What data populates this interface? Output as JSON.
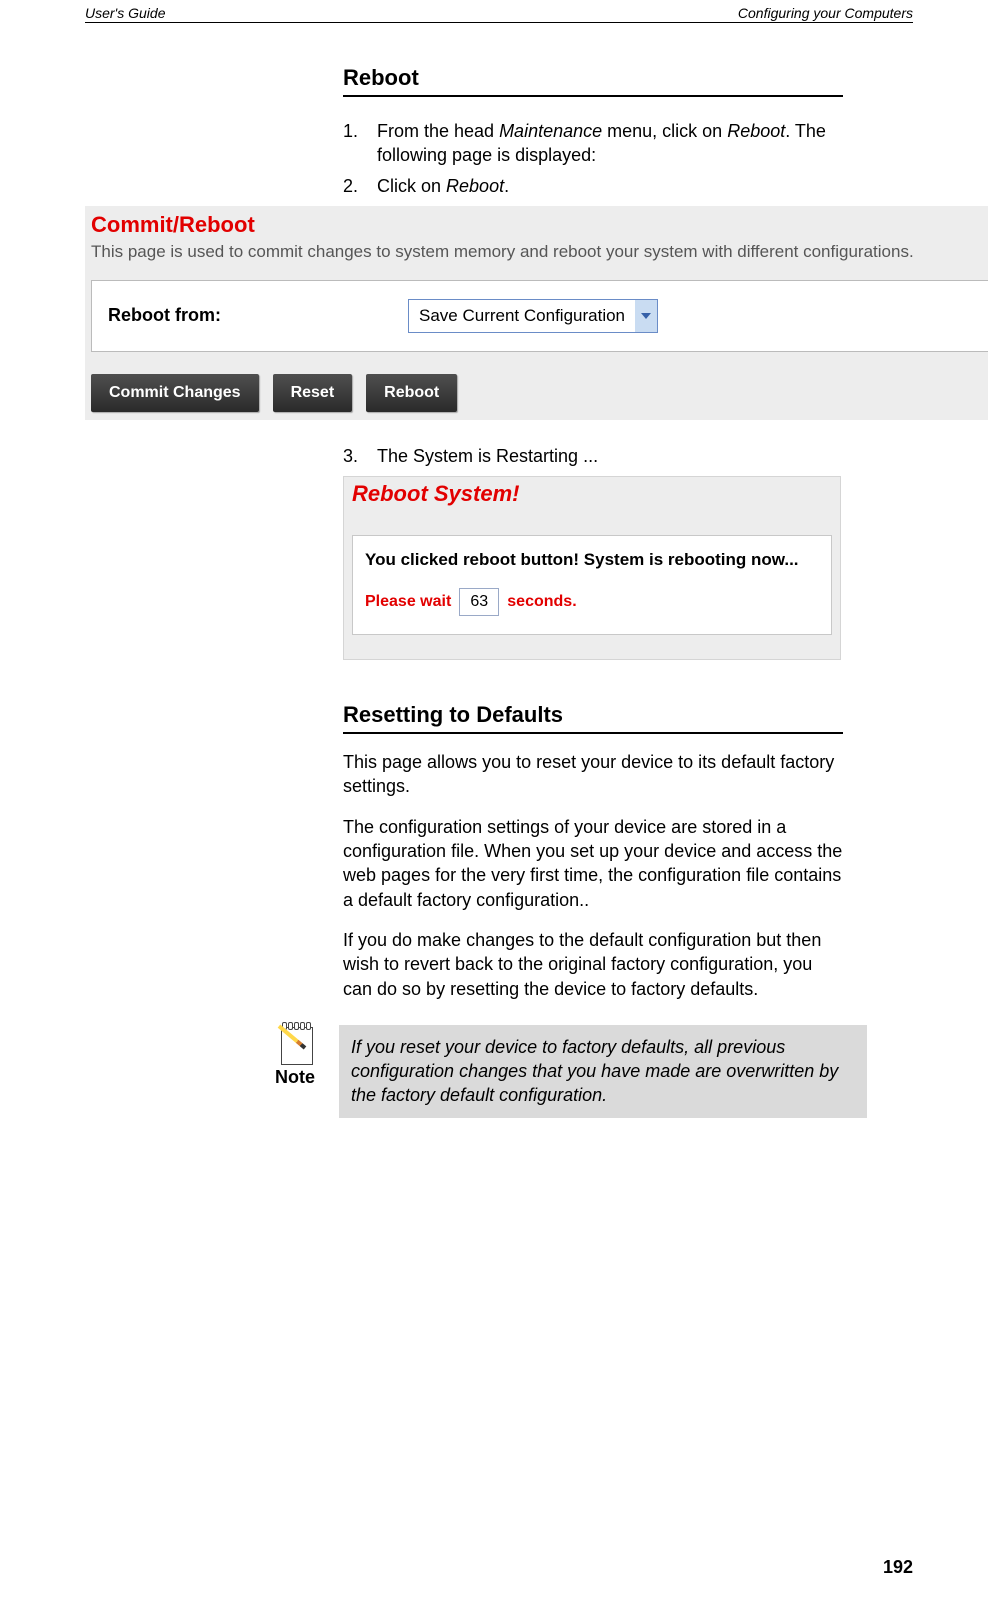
{
  "header": {
    "left": "User's Guide",
    "right": "Configuring your Computers"
  },
  "sections": {
    "reboot": {
      "title": "Reboot",
      "steps": {
        "s1_pre": "From the head ",
        "s1_ital1": "Maintenance",
        "s1_mid": " menu, click on ",
        "s1_ital2": "Reboot",
        "s1_post": ". The following page is displayed:",
        "s2_pre": "Click on ",
        "s2_ital": "Reboot",
        "s2_post": ".",
        "s3": "The System is Restarting ..."
      }
    },
    "resetting": {
      "title": "Resetting to Defaults",
      "p1": "This page allows you to reset your device to its default factory settings.",
      "p2": "The configuration settings of your device are stored in a configuration file. When you set up your device and access the web pages for the very first time, the configuration file contains a default factory configuration..",
      "p3": "If you do make changes to the default configuration but then wish to revert back to the original factory configuration, you can do so by resetting the device to factory defaults."
    }
  },
  "screenshot1": {
    "title": "Commit/Reboot",
    "description": "This page is used to commit changes to system memory and reboot your system with different configurations.",
    "label": "Reboot from:",
    "select_value": "Save Current Configuration",
    "buttons": {
      "commit": "Commit Changes",
      "reset": "Reset",
      "reboot": "Reboot"
    }
  },
  "screenshot2": {
    "title": "Reboot System!",
    "message": "You clicked reboot button! System is rebooting now...",
    "wait_pre": "Please wait",
    "seconds": "63",
    "wait_post": "seconds."
  },
  "note": {
    "label": "Note",
    "body": "If you reset your device to factory defaults, all previous configuration changes that you have made are overwritten by the factory default configuration."
  },
  "page_number": "192"
}
